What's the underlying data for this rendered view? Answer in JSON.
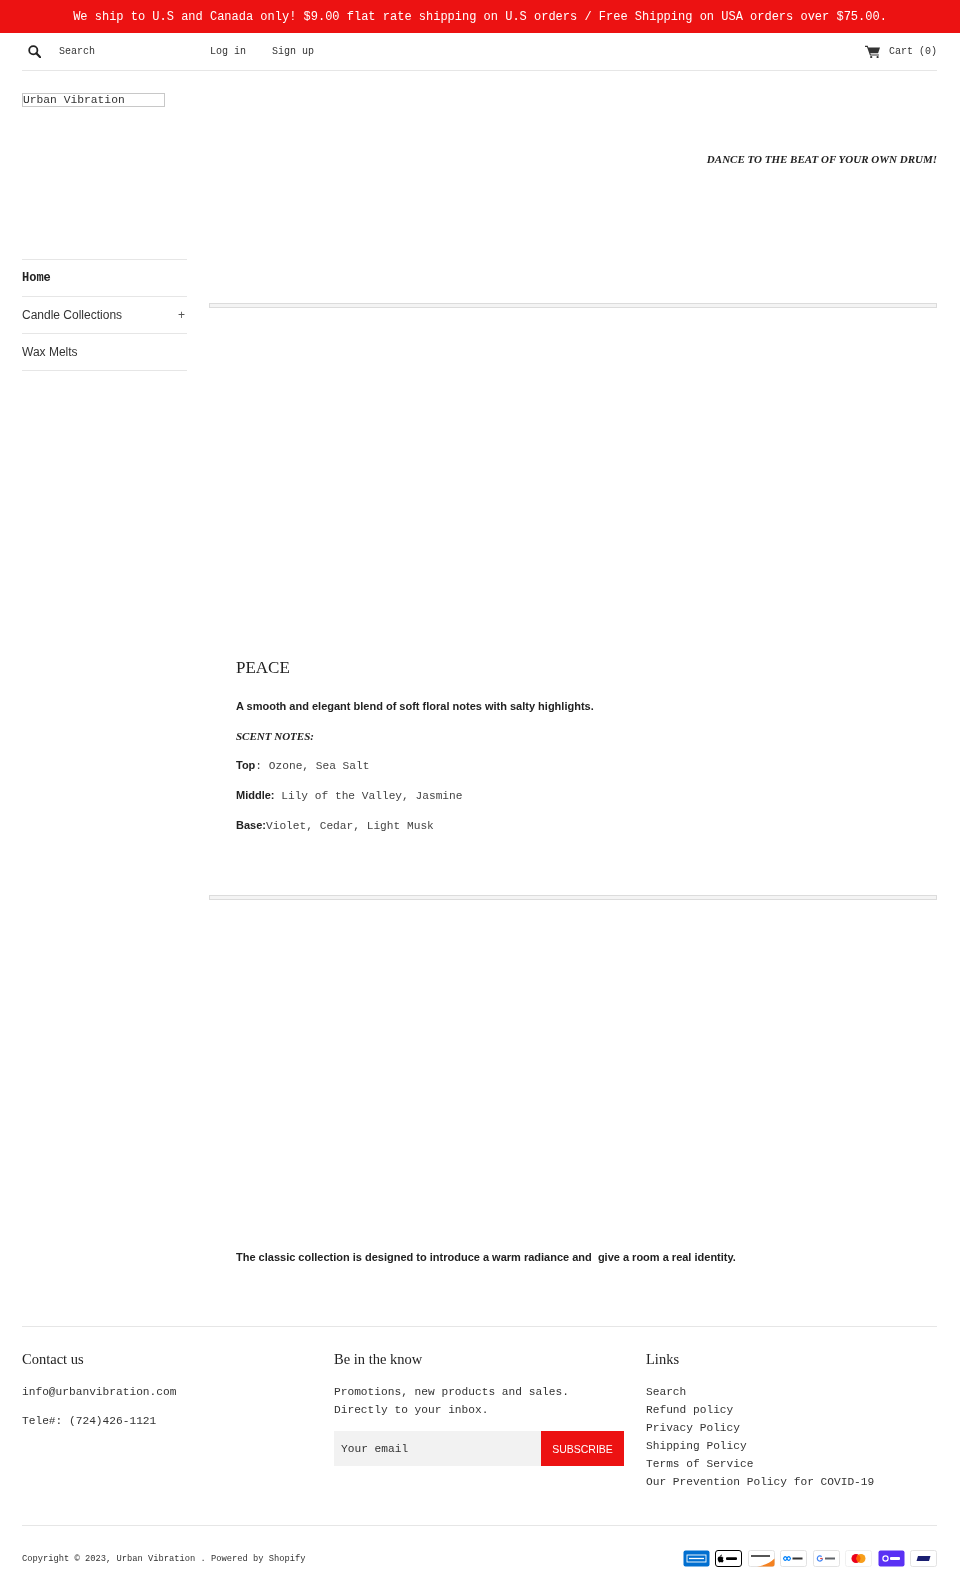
{
  "announcement": "We ship to U.S and Canada only! $9.00 flat rate shipping on U.S orders / Free Shipping on USA orders over $75.00.",
  "header": {
    "search": {
      "placeholder": "Search"
    },
    "account_links": [
      "Log in",
      "Sign up"
    ],
    "cart": "Cart (0)"
  },
  "sidebar": {
    "logo": "Urban Vibration",
    "nav": [
      {
        "label": "Home",
        "selected": true
      },
      {
        "label": "Candle Collections",
        "selected": false,
        "toggle": "+"
      },
      {
        "label": "Wax Melts",
        "selected": false
      }
    ]
  },
  "main": {
    "tagline": "DANCE TO THE BEAT OF YOUR OWN DRUM!",
    "product": {
      "title": "PEACE",
      "description": "A smooth and elegant blend of soft floral notes with salty highlights.",
      "notes_heading": "SCENT NOTES:",
      "notes": [
        "**Top**: Ozone, Sea Salt",
        "**Middle:** Lily of the Valley, Jasmine",
        "**Base:**Violet, Cedar, Light Musk"
      ]
    },
    "collection_text": "The classic collection is designed to introduce a warm radiance and  give a room a real identity."
  },
  "footer": {
    "contact": {
      "heading": "Contact us",
      "lines": [
        "info@urbanvibration.com",
        "Tele#: (724)426-1121"
      ]
    },
    "newsletter": {
      "heading": "Be in the know",
      "text": "Promotions, new products and sales. Directly to your inbox.",
      "email": {
        "placeholder": "Your email"
      },
      "button": "SUBSCRIBE"
    },
    "links": {
      "heading": "Links",
      "items": [
        "Search",
        "Refund policy",
        "Privacy Policy",
        "Shipping Policy",
        "Terms of Service",
        "Our Prevention Policy for COVID-19"
      ]
    },
    "copyright": {
      "prefix": "Copyright © 2023,",
      "store_link": "Urban Vibration",
      "separator": ".",
      "powered_link": "Powered by Shopify"
    }
  }
}
